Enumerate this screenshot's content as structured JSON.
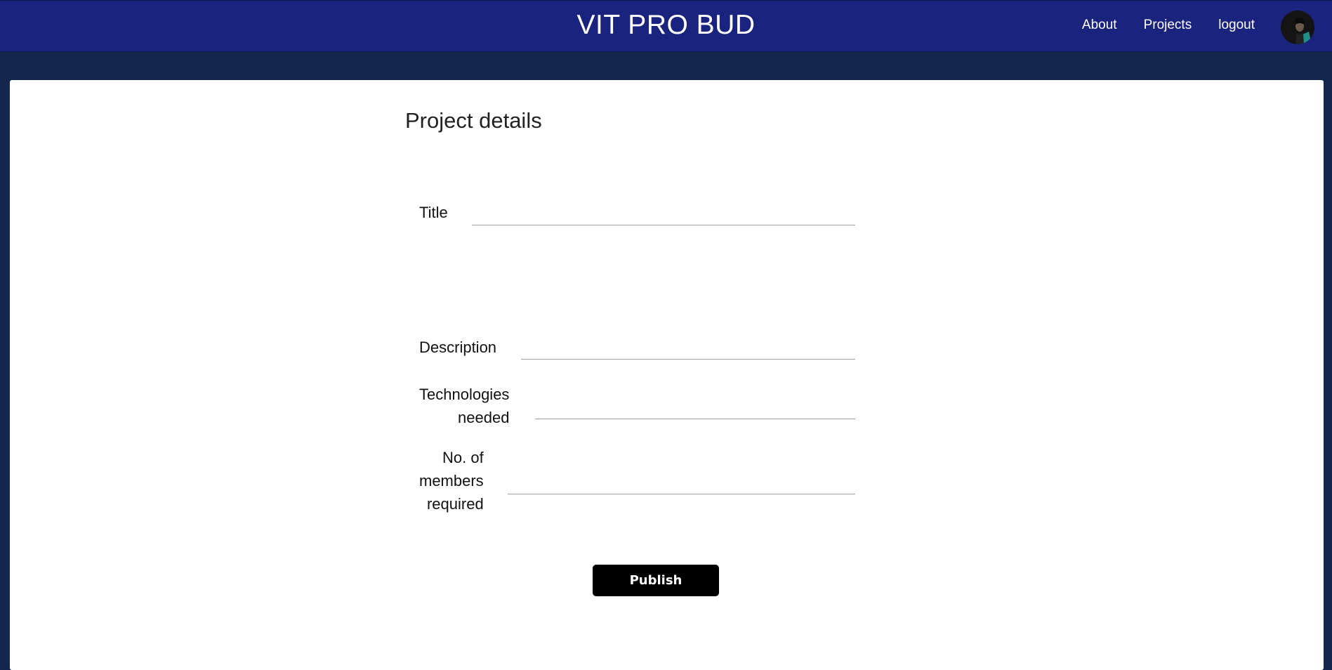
{
  "header": {
    "brand": "VIT PRO BUD",
    "nav": {
      "about": "About",
      "projects": "Projects",
      "logout": "logout"
    },
    "avatar_icon": "user-avatar-icon"
  },
  "form": {
    "title": "Project details",
    "fields": {
      "title": {
        "label": "Title",
        "value": ""
      },
      "description": {
        "label": "Description",
        "value": ""
      },
      "technologies": {
        "label_line1": "Technologies",
        "label_line2": "needed",
        "value": ""
      },
      "members": {
        "label_line1": "No. of",
        "label_line2": "members",
        "label_line3": "required",
        "value": ""
      }
    },
    "submit_label": "Publish"
  },
  "colors": {
    "header_bg": "#1a237e",
    "page_bg": "#14264e",
    "card_bg": "#ffffff",
    "button_bg": "#000000"
  }
}
